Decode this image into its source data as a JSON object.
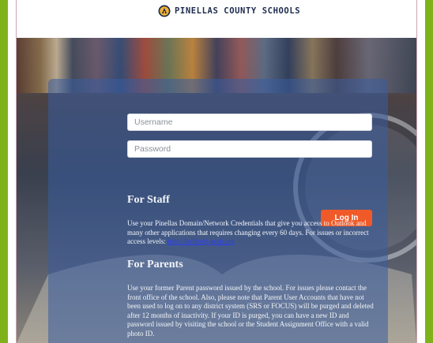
{
  "header": {
    "logo_text": "PINELLAS COUNTY SCHOOLS"
  },
  "login": {
    "username_placeholder": "Username",
    "password_placeholder": "Password",
    "login_label": "Log In"
  },
  "staff": {
    "heading": "For Staff",
    "text": "Use your Pinellas Domain/Network Credentials that give you access to Outlook and many other applications that requires changing every 60 days. For issues or incorrect access levels: ",
    "link_text": "http://techhelp.pcsb.org"
  },
  "parents": {
    "heading": "For Parents",
    "text": "Use your former Parent password issued by the school. For issues please contact the front office of the school. Also, please note that Parent User Accounts that have not been used to log on to any district system (SRS or FOCUS) will be purged and deleted after 12 months of inactivity. If your ID is purged, you can have a new ID and password issued by visiting the school or the Student Assignment Office with a valid photo ID."
  },
  "colors": {
    "frame_green": "#7fb21a",
    "login_orange": "#f05a28",
    "panel_blue": "#385ca0"
  }
}
